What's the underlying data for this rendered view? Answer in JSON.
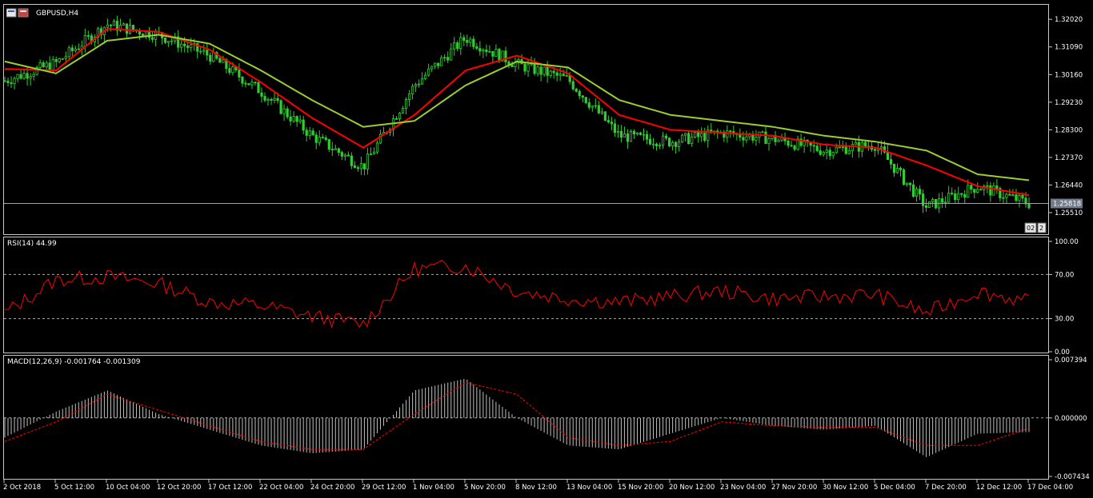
{
  "window": {
    "symbol_title": "GBPUSD,H4",
    "period_buttons": [
      "02",
      "2"
    ]
  },
  "colors": {
    "bull_candle": "#32cd32",
    "bear_candle": "#32cd32",
    "ma_fast": "#ff0000",
    "ma_slow": "#9acd32",
    "rsi_line": "#ff0000",
    "macd_hist": "#c0c0c0",
    "macd_signal": "#ff0000",
    "bid_line": "#a0a0a0"
  },
  "main": {
    "price_labels": [
      "1.32020",
      "1.31090",
      "1.30160",
      "1.29230",
      "1.28300",
      "1.27370",
      "1.26440",
      "1.25510"
    ],
    "price_ticks": [
      1.3202,
      1.3109,
      1.3016,
      1.2923,
      1.283,
      1.2737,
      1.2644,
      1.2551
    ],
    "current_price_label": "1.25818",
    "current_price": 1.25818
  },
  "rsi": {
    "title": "RSI(14) 44.99",
    "levels": [
      "100.00",
      "70.00",
      "30.00",
      "0.00"
    ],
    "level_values": [
      100,
      70,
      30,
      0
    ]
  },
  "macd": {
    "title": "MACD(12,26,9) -0.001764 -0.001309",
    "levels": [
      "0.007394",
      "0.000000",
      "-0.007434"
    ],
    "level_values": [
      0.007394,
      0,
      -0.007434
    ]
  },
  "time_axis": [
    "2 Oct 2018",
    "5 Oct 12:00",
    "10 Oct 04:00",
    "12 Oct 20:00",
    "17 Oct 12:00",
    "22 Oct 04:00",
    "24 Oct 20:00",
    "29 Oct 12:00",
    "1 Nov 04:00",
    "5 Nov 20:00",
    "8 Nov 12:00",
    "13 Nov 04:00",
    "15 Nov 20:00",
    "20 Nov 12:00",
    "23 Nov 04:00",
    "27 Nov 20:00",
    "30 Nov 12:00",
    "5 Dec 04:00",
    "7 Dec 20:00",
    "12 Dec 12:00",
    "17 Dec 04:00"
  ],
  "chart_data": [
    {
      "type": "candlestick",
      "title": "GBPUSD,H4",
      "ylim": [
        1.2481,
        1.3251
      ],
      "x": [
        "2 Oct 2018",
        "5 Oct 12:00",
        "10 Oct 04:00",
        "12 Oct 20:00",
        "17 Oct 12:00",
        "22 Oct 04:00",
        "24 Oct 20:00",
        "29 Oct 12:00",
        "1 Nov 04:00",
        "5 Nov 20:00",
        "8 Nov 12:00",
        "13 Nov 04:00",
        "15 Nov 20:00",
        "20 Nov 12:00",
        "23 Nov 04:00",
        "27 Nov 20:00",
        "30 Nov 12:00",
        "5 Dec 04:00",
        "7 Dec 20:00",
        "12 Dec 12:00",
        "17 Dec 04:00"
      ],
      "close_trend": [
        1.2995,
        1.3055,
        1.3185,
        1.315,
        1.308,
        1.296,
        1.281,
        1.2705,
        1.298,
        1.314,
        1.305,
        1.3,
        1.281,
        1.279,
        1.282,
        1.28,
        1.276,
        1.278,
        1.257,
        1.264,
        1.2582
      ],
      "series": [
        {
          "name": "MA fast",
          "values": [
            1.3035,
            1.303,
            1.317,
            1.316,
            1.31,
            1.299,
            1.287,
            1.277,
            1.288,
            1.303,
            1.308,
            1.302,
            1.288,
            1.283,
            1.282,
            1.281,
            1.278,
            1.277,
            1.271,
            1.264,
            1.261
          ]
        },
        {
          "name": "MA slow",
          "values": [
            1.306,
            1.302,
            1.313,
            1.315,
            1.312,
            1.303,
            1.293,
            1.284,
            1.286,
            1.298,
            1.306,
            1.304,
            1.293,
            1.288,
            1.286,
            1.284,
            1.281,
            1.279,
            1.276,
            1.268,
            1.266
          ]
        }
      ],
      "current_price": 1.25818
    },
    {
      "type": "line",
      "title": "RSI(14) 44.99",
      "ylim": [
        0,
        100
      ],
      "levels": [
        70,
        30
      ],
      "x": [
        "2 Oct 2018",
        "5 Oct 12:00",
        "10 Oct 04:00",
        "12 Oct 20:00",
        "17 Oct 12:00",
        "22 Oct 04:00",
        "24 Oct 20:00",
        "29 Oct 12:00",
        "1 Nov 04:00",
        "5 Nov 20:00",
        "8 Nov 12:00",
        "13 Nov 04:00",
        "15 Nov 20:00",
        "20 Nov 12:00",
        "23 Nov 04:00",
        "27 Nov 20:00",
        "30 Nov 12:00",
        "5 Dec 04:00",
        "7 Dec 20:00",
        "12 Dec 12:00",
        "17 Dec 04:00"
      ],
      "values": [
        35,
        65,
        68,
        62,
        45,
        42,
        32,
        25,
        75,
        78,
        55,
        48,
        45,
        50,
        55,
        48,
        50,
        52,
        35,
        55,
        45
      ]
    },
    {
      "type": "bar",
      "title": "MACD(12,26,9) -0.001764 -0.001309",
      "ylim": [
        -0.007434,
        0.007394
      ],
      "x": [
        "2 Oct 2018",
        "5 Oct 12:00",
        "10 Oct 04:00",
        "12 Oct 20:00",
        "17 Oct 12:00",
        "22 Oct 04:00",
        "24 Oct 20:00",
        "29 Oct 12:00",
        "1 Nov 04:00",
        "5 Nov 20:00",
        "8 Nov 12:00",
        "13 Nov 04:00",
        "15 Nov 20:00",
        "20 Nov 12:00",
        "23 Nov 04:00",
        "27 Nov 20:00",
        "30 Nov 12:00",
        "5 Dec 04:00",
        "7 Dec 20:00",
        "12 Dec 12:00",
        "17 Dec 04:00"
      ],
      "histogram": [
        -0.0025,
        0.0008,
        0.0035,
        0.0005,
        -0.0015,
        -0.0035,
        -0.0045,
        -0.004,
        0.0035,
        0.005,
        0.0,
        -0.0035,
        -0.004,
        -0.002,
        0.0,
        -0.001,
        -0.0015,
        -0.001,
        -0.005,
        -0.002,
        -0.0018
      ],
      "signal": [
        -0.003,
        -0.0005,
        0.003,
        0.001,
        -0.001,
        -0.003,
        -0.004,
        -0.004,
        0.0005,
        0.0045,
        0.003,
        -0.0025,
        -0.0035,
        -0.003,
        -0.0005,
        -0.001,
        -0.0012,
        -0.0012,
        -0.0035,
        -0.0035,
        -0.0013
      ]
    }
  ]
}
